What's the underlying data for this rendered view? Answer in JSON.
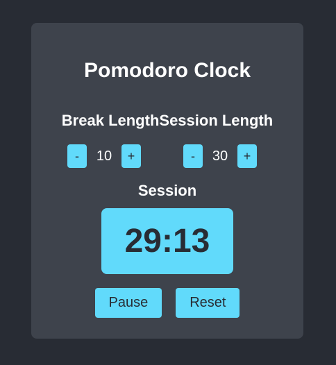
{
  "app": {
    "title": "Pomodoro Clock"
  },
  "break": {
    "label": "Break Length",
    "decrement": "-",
    "value": "10",
    "increment": "+"
  },
  "session": {
    "label": "Session Length",
    "decrement": "-",
    "value": "30",
    "increment": "+"
  },
  "timer": {
    "label": "Session",
    "time": "29:13"
  },
  "actions": {
    "pause_label": "Pause",
    "reset_label": "Reset"
  },
  "colors": {
    "background": "#282c34",
    "card": "#3e434c",
    "accent": "#61dafb",
    "text": "#ffffff",
    "dark_text": "#282c34"
  }
}
